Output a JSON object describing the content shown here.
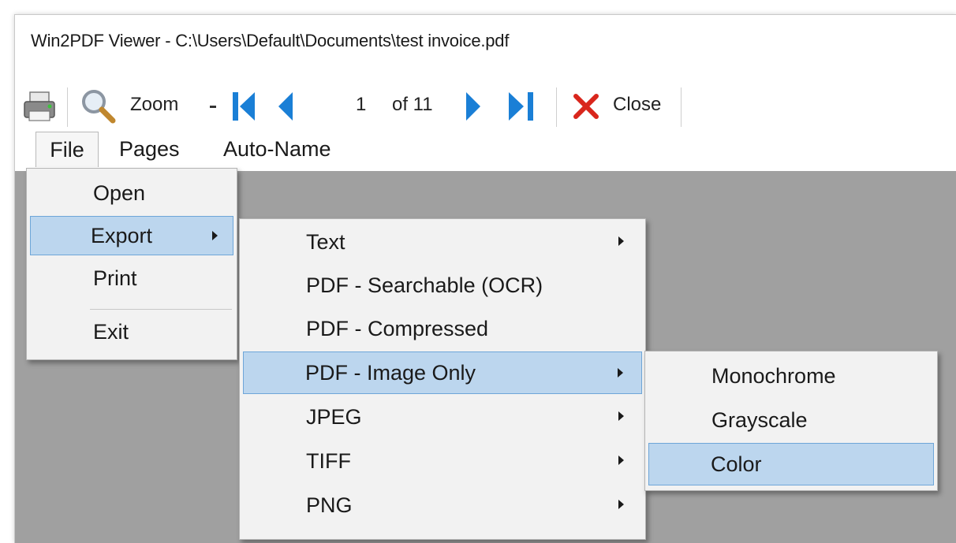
{
  "window": {
    "title": "Win2PDF Viewer - C:\\Users\\Default\\Documents\\test invoice.pdf"
  },
  "toolbar": {
    "zoom_label": "Zoom",
    "page_number": "1",
    "page_count": "of 11",
    "close_label": "Close"
  },
  "menubar": {
    "items": [
      "File",
      "Pages",
      "Auto-Name"
    ]
  },
  "file_menu": {
    "items": [
      "Open",
      "Export",
      "Print",
      "Exit"
    ]
  },
  "export_menu": {
    "items": [
      "Text",
      "PDF - Searchable (OCR)",
      "PDF - Compressed",
      "PDF - Image Only",
      "JPEG",
      "TIFF",
      "PNG"
    ]
  },
  "image_only_menu": {
    "items": [
      "Monochrome",
      "Grayscale",
      "Color"
    ]
  },
  "colors": {
    "highlight_fill": "#bcd6ee",
    "highlight_border": "#6ea6d8",
    "nav_blue": "#1a7fd6",
    "close_red": "#d9261c",
    "workspace": "#a0a0a0"
  },
  "icons": {
    "print": "printer-icon",
    "zoom": "magnifier-icon",
    "first": "first-page-icon",
    "prev": "previous-page-icon",
    "next": "next-page-icon",
    "last": "last-page-icon",
    "close": "close-x-icon"
  }
}
